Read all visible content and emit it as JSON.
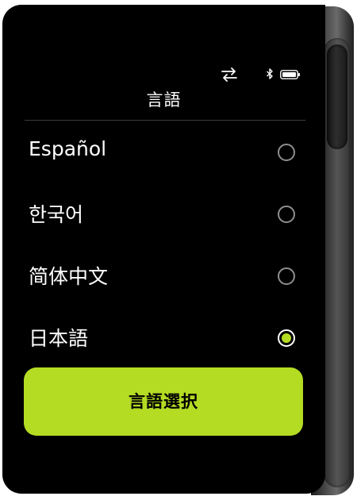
{
  "header": {
    "title": "言語"
  },
  "status_icons": {
    "sync": "sync-arrows-icon",
    "bluetooth": "bluetooth-icon",
    "battery": "battery-full-icon"
  },
  "languages": [
    {
      "label": "Español",
      "selected": false
    },
    {
      "label": "한국어",
      "selected": false
    },
    {
      "label": "简体中文",
      "selected": false
    },
    {
      "label": "日本語",
      "selected": true
    }
  ],
  "action": {
    "select_label": "言語選択"
  },
  "colors": {
    "accent": "#b4dc23",
    "background": "#000000",
    "text": "#ffffff"
  }
}
